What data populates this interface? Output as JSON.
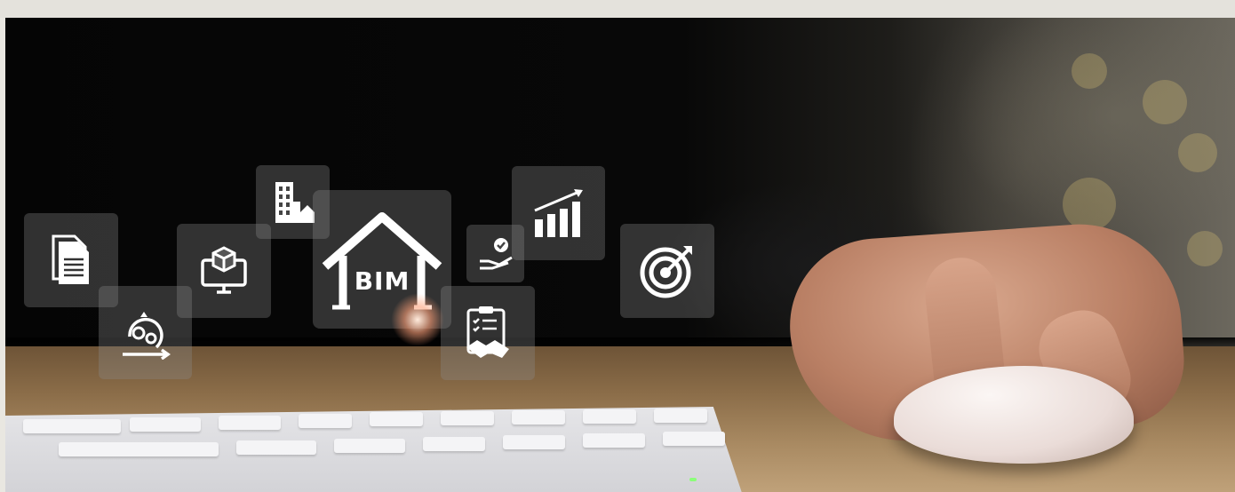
{
  "bim_label": "BIM",
  "icons": [
    "document-icon",
    "process-cycle-icon",
    "box-monitor-icon",
    "buildings-icon",
    "bim-house-icon",
    "hand-check-icon",
    "growth-chart-icon",
    "contract-handshake-icon",
    "target-icon"
  ],
  "colors": {
    "tile": "#8c8c8c",
    "icon": "#ffffff"
  }
}
